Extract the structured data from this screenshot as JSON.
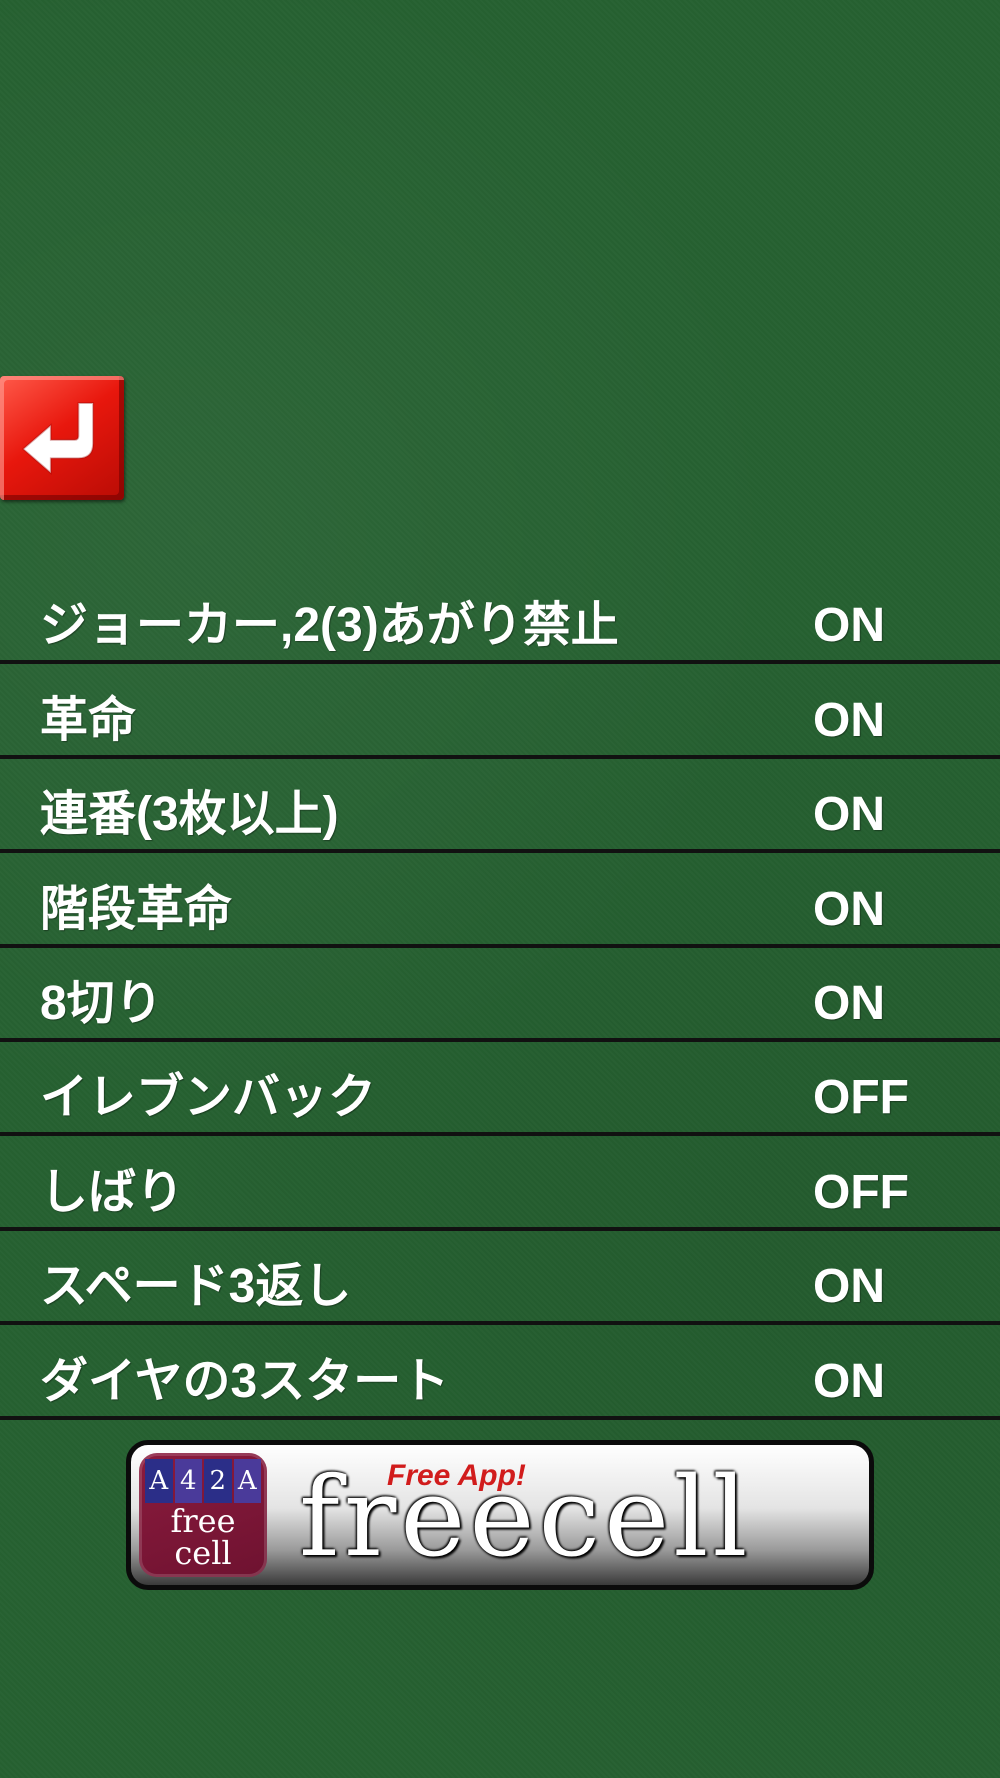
{
  "back_button": {
    "icon": "return-arrow-icon"
  },
  "settings": [
    {
      "label": "ジョーカー,2(3)あがり禁止",
      "value": "ON"
    },
    {
      "label": "革命",
      "value": "ON"
    },
    {
      "label": "連番(3枚以上)",
      "value": "ON"
    },
    {
      "label": "階段革命",
      "value": "ON"
    },
    {
      "label": "8切り",
      "value": "ON"
    },
    {
      "label": "イレブンバック",
      "value": "OFF"
    },
    {
      "label": "しばり",
      "value": "OFF"
    },
    {
      "label": "スペード3返し",
      "value": "ON"
    },
    {
      "label": "ダイヤの3スタート",
      "value": "ON"
    }
  ],
  "ad": {
    "tagline": "Free App!",
    "brand": "freecell",
    "icon_cards": [
      "A",
      "4",
      "2",
      "A"
    ],
    "icon_brand_line1": "free",
    "icon_brand_line2": "cell"
  },
  "colors": {
    "background": "#266131",
    "divider": "#111111",
    "back_button": "#e8170d",
    "ad_tagline": "#d11c1c"
  }
}
